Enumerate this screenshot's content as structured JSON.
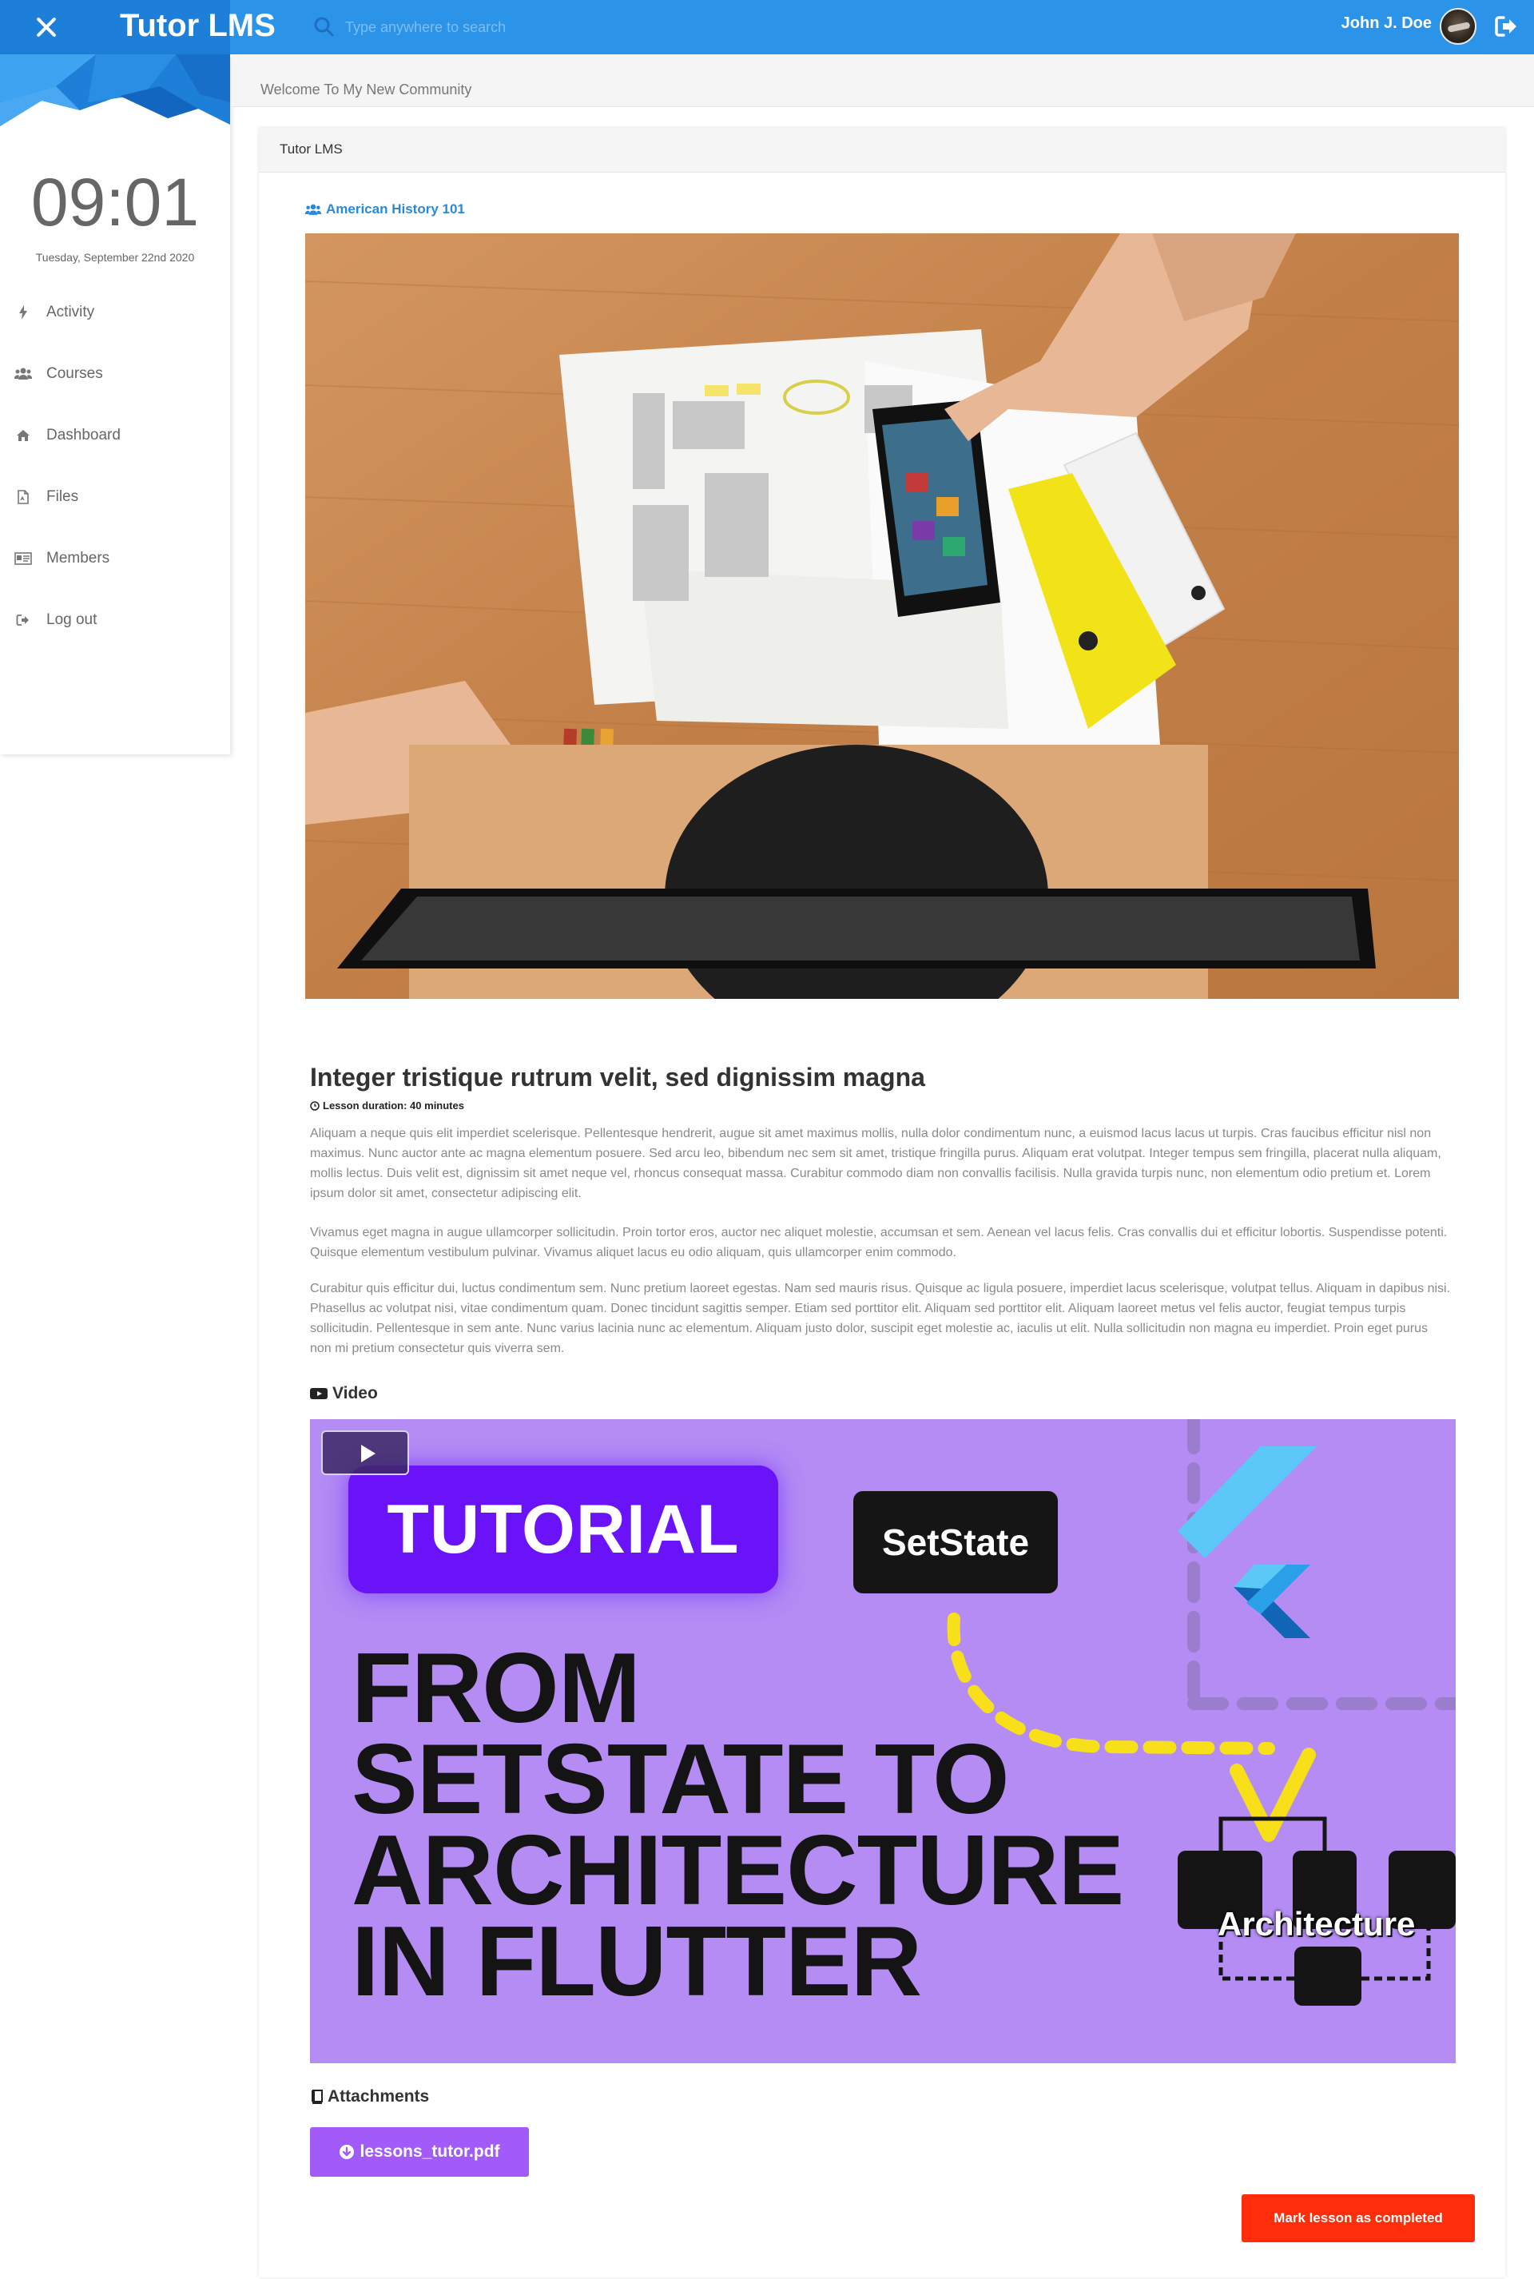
{
  "header": {
    "brand": "Tutor LMS",
    "search_placeholder": "Type anywhere to search",
    "user_name": "John J. Doe"
  },
  "sidebar": {
    "time": "09:01",
    "date": "Tuesday, September 22nd 2020",
    "items": [
      {
        "label": "Activity",
        "icon": "bolt-icon"
      },
      {
        "label": "Courses",
        "icon": "users-icon"
      },
      {
        "label": "Dashboard",
        "icon": "home-icon"
      },
      {
        "label": "Files",
        "icon": "file-icon"
      },
      {
        "label": "Members",
        "icon": "id-card-icon"
      },
      {
        "label": "Log out",
        "icon": "sign-out-icon"
      }
    ]
  },
  "breadcrumb": "Welcome To My New Community",
  "card": {
    "title": "Tutor LMS",
    "course_link": "American History 101",
    "lesson_title": "Integer tristique rutrum velit, sed dignissim magna",
    "duration": "Lesson duration: 40 minutes",
    "paragraphs": [
      "Aliquam a neque quis elit imperdiet scelerisque. Pellentesque hendrerit, augue sit amet maximus mollis, nulla dolor condimentum nunc, a euismod lacus lacus ut turpis. Cras faucibus efficitur nisl non maximus. Nunc auctor ante ac magna elementum posuere. Sed arcu leo, bibendum nec sem sit amet, tristique fringilla purus. Aliquam erat volutpat. Integer tempus sem fringilla, placerat nulla aliquam, mollis lectus. Duis velit est, dignissim sit amet neque vel, rhoncus consequat massa. Curabitur commodo diam non convallis facilisis. Nulla gravida turpis nunc, non elementum odio pretium et. Lorem ipsum dolor sit amet, consectetur adipiscing elit.",
      "Vivamus eget magna in augue ullamcorper sollicitudin. Proin tortor eros, auctor nec aliquet molestie, accumsan et sem. Aenean vel lacus felis. Cras convallis dui et efficitur lobortis. Suspendisse potenti. Quisque elementum vestibulum pulvinar. Vivamus aliquet lacus eu odio aliquam, quis ullamcorper enim commodo.",
      "Curabitur quis efficitur dui, luctus condimentum sem. Nunc pretium laoreet egestas. Nam sed mauris risus. Quisque ac ligula posuere, imperdiet lacus scelerisque, volutpat tellus. Aliquam in dapibus nisi. Phasellus ac volutpat nisi, vitae condimentum quam. Donec tincidunt sagittis semper. Etiam sed porttitor elit. Aliquam sed porttitor elit. Aliquam laoreet metus vel felis auctor, feugiat tempus turpis sollicitudin. Pellentesque in sem ante. Nunc varius lacinia nunc ac elementum. Aliquam justo dolor, suscipit eget molestie ac, iaculis ut elit. Nulla sollicitudin non magna eu imperdiet. Proin eget purus non mi pretium consectetur quis viverra sem."
    ],
    "video_label": "Video",
    "video_thumb": {
      "tag": "TUTORIAL",
      "badge": "SetState",
      "headline": [
        "FROM",
        "SETSTATE TO",
        "ARCHITECTURE",
        "IN FLUTTER"
      ],
      "diagram_label": "Architecture"
    },
    "attachments_label": "Attachments",
    "attachment_file": "lessons_tutor.pdf",
    "complete_label": "Mark lesson as completed"
  },
  "colors": {
    "primary": "#2b93e8",
    "link": "#2b8ad8",
    "attachment": "#a25af8",
    "complete": "#ff2d0a",
    "video_bg": "#b48cf4"
  }
}
